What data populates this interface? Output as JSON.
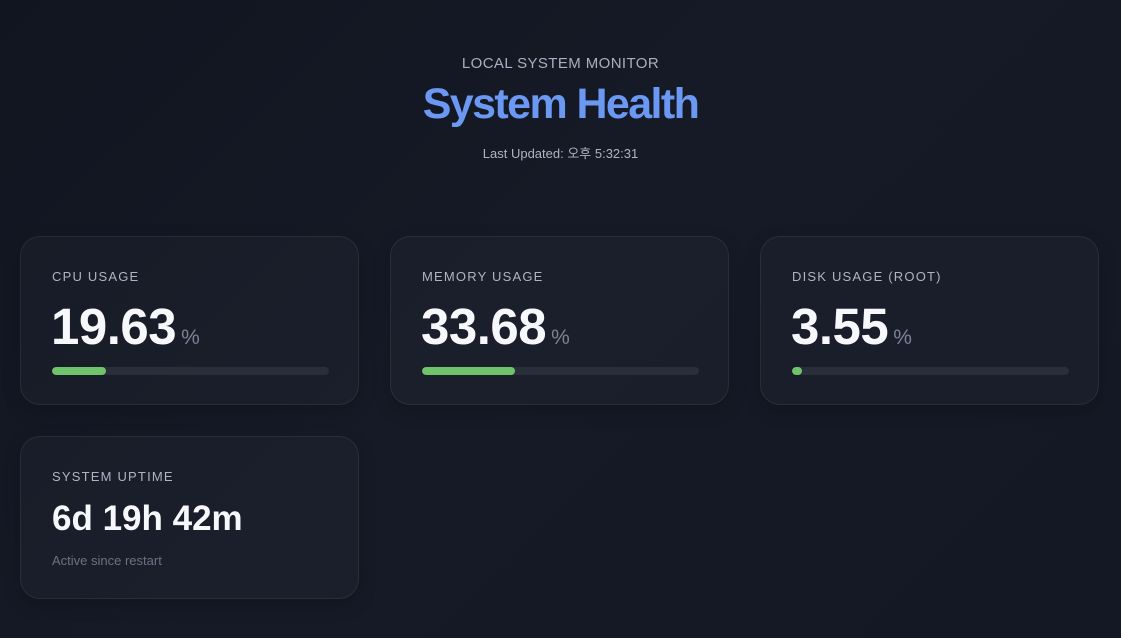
{
  "header": {
    "eyebrow": "LOCAL SYSTEM MONITOR",
    "title": "System Health",
    "last_updated": "Last Updated: 오후 5:32:31"
  },
  "colors": {
    "accent": "#6b98f2",
    "bar_fill": "#6fc46b",
    "bar_track": "#2a2e3b"
  },
  "cards": {
    "cpu": {
      "label": "CPU USAGE",
      "value": "19.63",
      "unit": "%",
      "percent": 19.63
    },
    "memory": {
      "label": "MEMORY USAGE",
      "value": "33.68",
      "unit": "%",
      "percent": 33.68
    },
    "disk": {
      "label": "DISK USAGE (ROOT)",
      "value": "3.55",
      "unit": "%",
      "percent": 3.55
    },
    "uptime": {
      "label": "SYSTEM UPTIME",
      "value": "6d 19h 42m",
      "note": "Active since restart"
    }
  }
}
